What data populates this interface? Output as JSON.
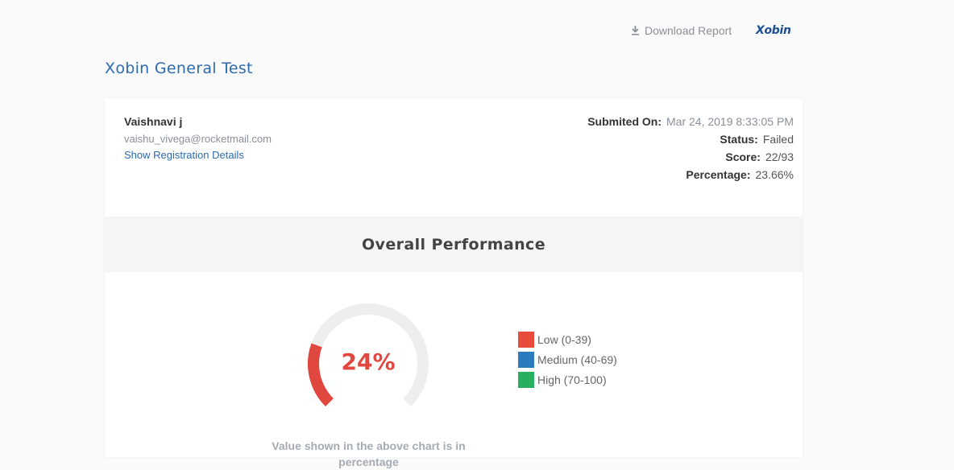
{
  "header": {
    "download_label": "Download Report",
    "download_icon": "download-icon",
    "brand": "Xobin"
  },
  "page_title": "Xobin General Test",
  "candidate": {
    "name": "Vaishnavi j",
    "email": "vaishu_vivega@rocketmail.com",
    "registration_link": "Show Registration Details"
  },
  "summary": {
    "submitted_label": "Submited On:",
    "submitted_value": "Mar 24, 2019 8:33:05 PM",
    "status_label": "Status:",
    "status_value": "Failed",
    "score_label": "Score:",
    "score_value": "22/93",
    "percentage_label": "Percentage:",
    "percentage_value": "23.66%"
  },
  "performance": {
    "title": "Overall Performance",
    "gauge_label": "24%",
    "gauge_value": 24,
    "gauge_color": "#e0473f",
    "track_color": "#eeeeee",
    "legend": [
      {
        "label": "Low (0-39)",
        "color": "#e74c3c"
      },
      {
        "label": "Medium (40-69)",
        "color": "#2c7bbf"
      },
      {
        "label": "High (70-100)",
        "color": "#27ae60"
      }
    ],
    "note": "Value shown in the above chart is in percentage"
  }
}
